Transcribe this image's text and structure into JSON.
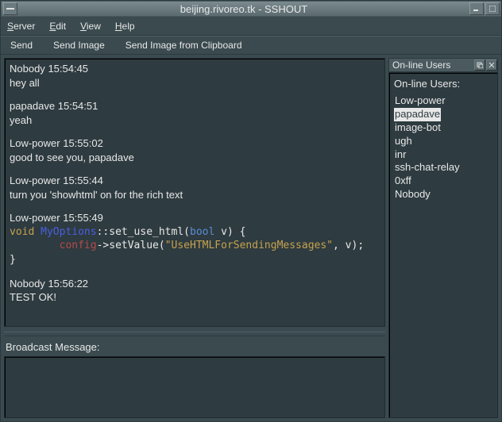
{
  "window": {
    "title": "beijing.rivoreo.tk - SSHOUT"
  },
  "menubar": {
    "server": "Server",
    "edit": "Edit",
    "view": "View",
    "help": "Help"
  },
  "toolbar": {
    "send": "Send",
    "send_image": "Send Image",
    "send_image_clip": "Send Image from Clipboard"
  },
  "chat": {
    "messages": [
      {
        "user": "Nobody",
        "time": "15:54:45",
        "body": "hey all"
      },
      {
        "user": "papadave",
        "time": "15:54:51",
        "body": "yeah"
      },
      {
        "user": "Low-power",
        "time": "15:55:02",
        "body": "good to see you, papadave"
      },
      {
        "user": "Low-power",
        "time": "15:55:44",
        "body": "turn you 'showhtml' on for the rich text"
      }
    ],
    "code_msg": {
      "user": "Low-power",
      "time": "15:55:49",
      "kw_void": "void",
      "kw_class": "MyOptions",
      "kw_fn": "::set_use_html(",
      "kw_type": "bool",
      "kw_param": " v) {",
      "line2_mem": "config",
      "line2_rest": "->setValue(",
      "line2_str": "\"UseHTMLForSendingMessages\"",
      "line2_tail": ", v);",
      "line3": "}"
    },
    "last_msg": {
      "user": "Nobody",
      "time": "15:56:22",
      "body": "TEST OK!"
    }
  },
  "broadcast": {
    "label": "Broadcast Message:",
    "value": ""
  },
  "users_panel": {
    "header": "On-line Users",
    "title": "On-line Users:",
    "list": [
      "Low-power",
      "papadave",
      "image-bot",
      "ugh",
      "inr",
      "ssh-chat-relay",
      "0xff",
      "Nobody"
    ],
    "selected": "papadave"
  }
}
